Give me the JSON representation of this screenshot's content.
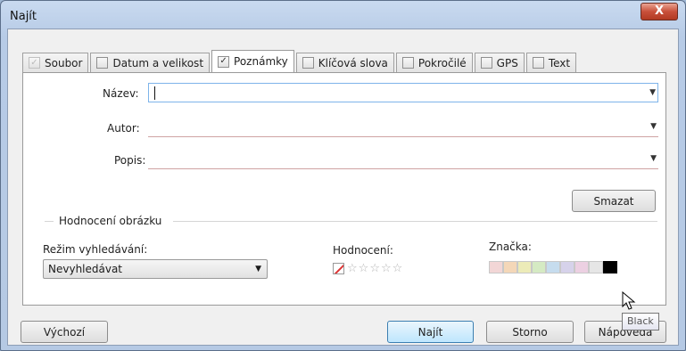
{
  "window": {
    "title": "Najít",
    "close_label": "X"
  },
  "tabs": [
    {
      "label": "Soubor",
      "checked": true,
      "disabled": true
    },
    {
      "label": "Datum a velikost",
      "checked": false
    },
    {
      "label": "Poznámky",
      "checked": true,
      "active": true
    },
    {
      "label": "Klíčová slova",
      "checked": false
    },
    {
      "label": "Pokročilé",
      "checked": false
    },
    {
      "label": "GPS",
      "checked": false
    },
    {
      "label": "Text",
      "checked": false
    }
  ],
  "fields": {
    "name_label": "Název:",
    "name_value": "",
    "author_label": "Autor:",
    "author_value": "",
    "description_label": "Popis:",
    "description_value": ""
  },
  "clear_button": "Smazat",
  "rating_group": {
    "title": "Hodnocení obrázku",
    "search_mode_label": "Režim vyhledávání:",
    "search_mode_value": "Nevyhledávat",
    "rating_label": "Hodnocení:",
    "rating_value": 0,
    "rating_max": 5,
    "tag_label": "Značka:",
    "tag_colors": [
      "#f2d6d6",
      "#f4d7b8",
      "#ecebb8",
      "#d5eac3",
      "#c6dcee",
      "#d6d2ea",
      "#ecd0e2",
      "#e6e6e6",
      "#000000"
    ]
  },
  "tooltip": "Black",
  "footer": {
    "default_button": "Výchozí",
    "find_button": "Najít",
    "cancel_button": "Storno",
    "help_button": "Nápověda"
  }
}
